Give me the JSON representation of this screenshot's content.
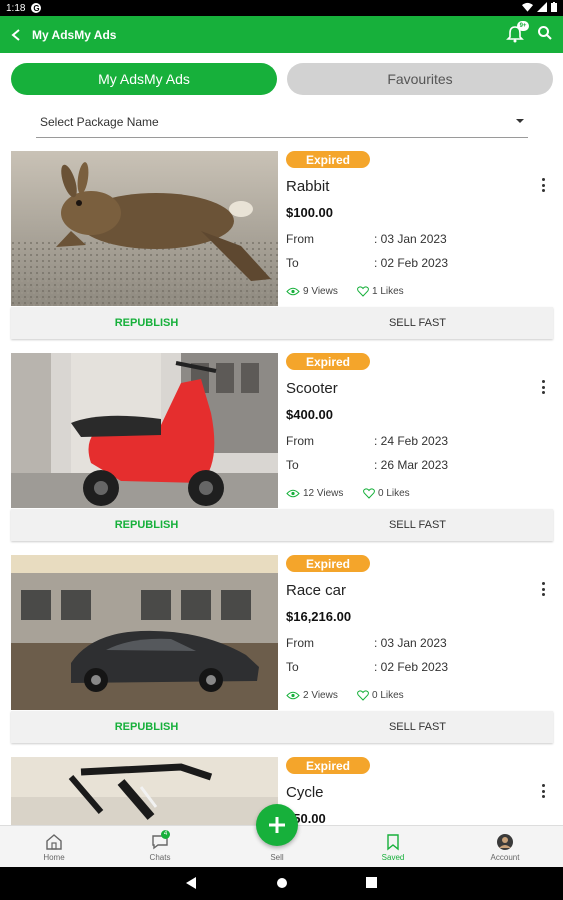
{
  "statusbar": {
    "time": "1:18",
    "app_icon": "G"
  },
  "appbar": {
    "title": "My AdsMy Ads",
    "notification_badge": "9+"
  },
  "tabs": {
    "my_ads": "My AdsMy Ads",
    "favourites": "Favourites"
  },
  "package_select": {
    "label": "Select Package Name"
  },
  "ads": [
    {
      "status": "Expired",
      "name": "Rabbit",
      "price": "$100.00",
      "from_label": "From",
      "from_value": ": 03 Jan 2023",
      "to_label": "To",
      "to_value": ": 02 Feb 2023",
      "views": "9 Views",
      "likes": "1 Likes",
      "republish": "REPUBLISH",
      "sell_fast": "SELL FAST"
    },
    {
      "status": "Expired",
      "name": "Scooter",
      "price": "$400.00",
      "from_label": "From",
      "from_value": ": 24 Feb 2023",
      "to_label": "To",
      "to_value": ": 26 Mar 2023",
      "views": "12 Views",
      "likes": "0 Likes",
      "republish": "REPUBLISH",
      "sell_fast": "SELL FAST"
    },
    {
      "status": "Expired",
      "name": "Race car",
      "price": "$16,216.00",
      "from_label": "From",
      "from_value": ": 03 Jan 2023",
      "to_label": "To",
      "to_value": ": 02 Feb 2023",
      "views": "2 Views",
      "likes": "0 Likes",
      "republish": "REPUBLISH",
      "sell_fast": "SELL FAST"
    },
    {
      "status": "Expired",
      "name": "Cycle",
      "price": "$50.00"
    }
  ],
  "bottom_nav": {
    "home": "Home",
    "chats": "Chats",
    "chats_badge": "4",
    "sell": "Sell",
    "saved": "Saved",
    "account": "Account"
  },
  "colors": {
    "brand": "#17b03b",
    "expired": "#f4a52b"
  }
}
